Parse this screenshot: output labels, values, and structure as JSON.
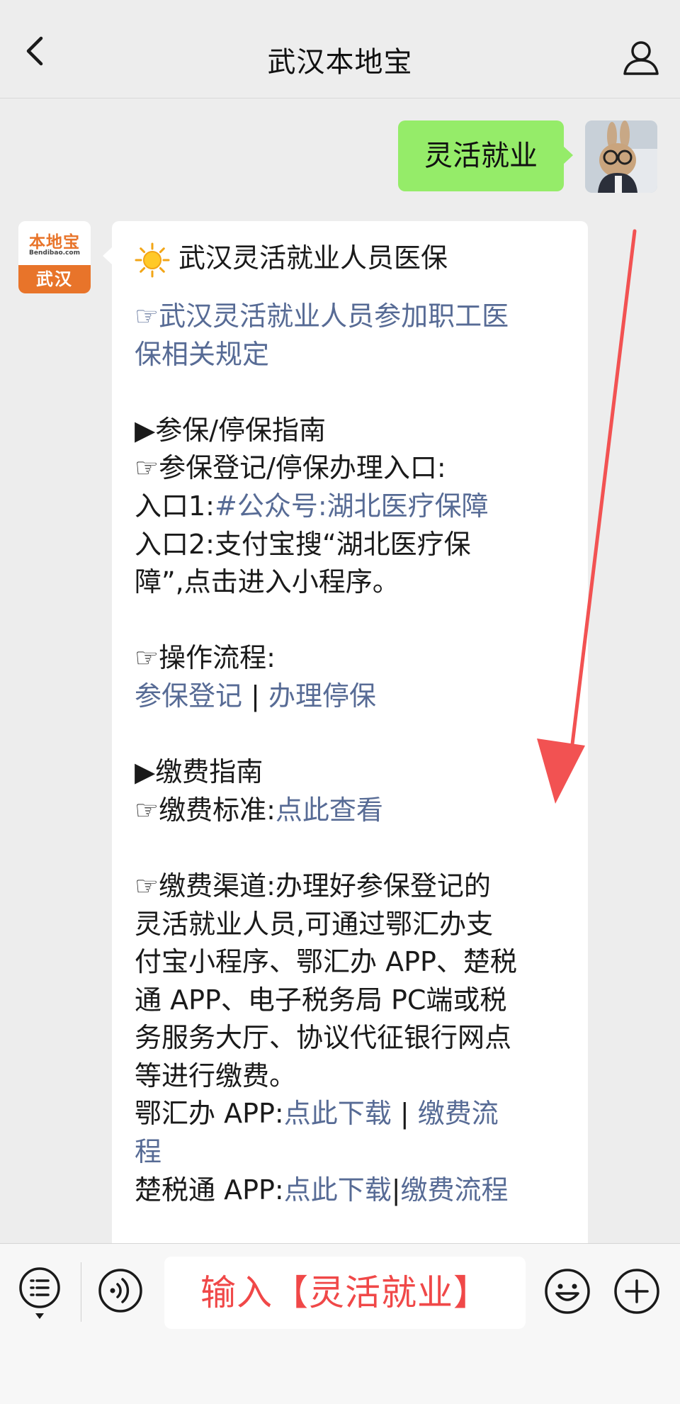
{
  "header": {
    "title": "武汉本地宝"
  },
  "icons": {
    "back": "chevron-left-icon",
    "profile": "person-icon",
    "menu": "list-menu-icon",
    "voice": "voice-icon",
    "emoji": "smiley-icon",
    "plus": "plus-circle-icon",
    "sun": "sun-icon"
  },
  "chat": {
    "user_message": "灵活就业",
    "bot_avatar": {
      "logo": "本地宝",
      "url": "Bendibao.com",
      "city": "武汉"
    },
    "bot_message": {
      "heading": "武汉灵活就业人员医保",
      "intro_link_1": "☞武汉灵活就业人员参加职工医",
      "intro_link_2": "保相关规定",
      "section1_title": "▶参保/停保指南",
      "entry_label": "☞参保登记/停保办理入口:",
      "entry1_prefix": "入口1:",
      "entry1_link": "#公众号:湖北医疗保障",
      "entry2_line1": "入口2:支付宝搜“湖北医疗保",
      "entry2_line2": "障”,点击进入小程序。",
      "flow_label": "☞操作流程:",
      "flow_link1": "参保登记",
      "flow_sep": " | ",
      "flow_link2": "办理停保",
      "section2_title": "▶缴费指南",
      "standard_label": "☞缴费标准:",
      "standard_link": "点此查看",
      "channel_lines": [
        "☞缴费渠道:办理好参保登记的",
        "灵活就业人员,可通过鄂汇办支",
        "付宝小程序、鄂汇办 APP、楚税",
        "通 APP、电子税务局 PC端或税",
        "务服务大厅、协议代征银行网点",
        "等进行缴费。"
      ],
      "ehb_label": "鄂汇办 APP:",
      "ehb_download": "点此下载",
      "ehb_sep": " | ",
      "ehb_flow_1": "缴费流",
      "ehb_flow_2": "程",
      "cst_label": "楚税通 APP:",
      "cst_download": "点此下载",
      "cst_sep": "|",
      "cst_flow": "缴费流程"
    }
  },
  "input": {
    "text": "输入【灵活就业】"
  },
  "colors": {
    "background": "#ededed",
    "user_bubble": "#95ec69",
    "link": "#576b95",
    "annotation_red": "#f04848",
    "brand_orange": "#e8742a"
  }
}
